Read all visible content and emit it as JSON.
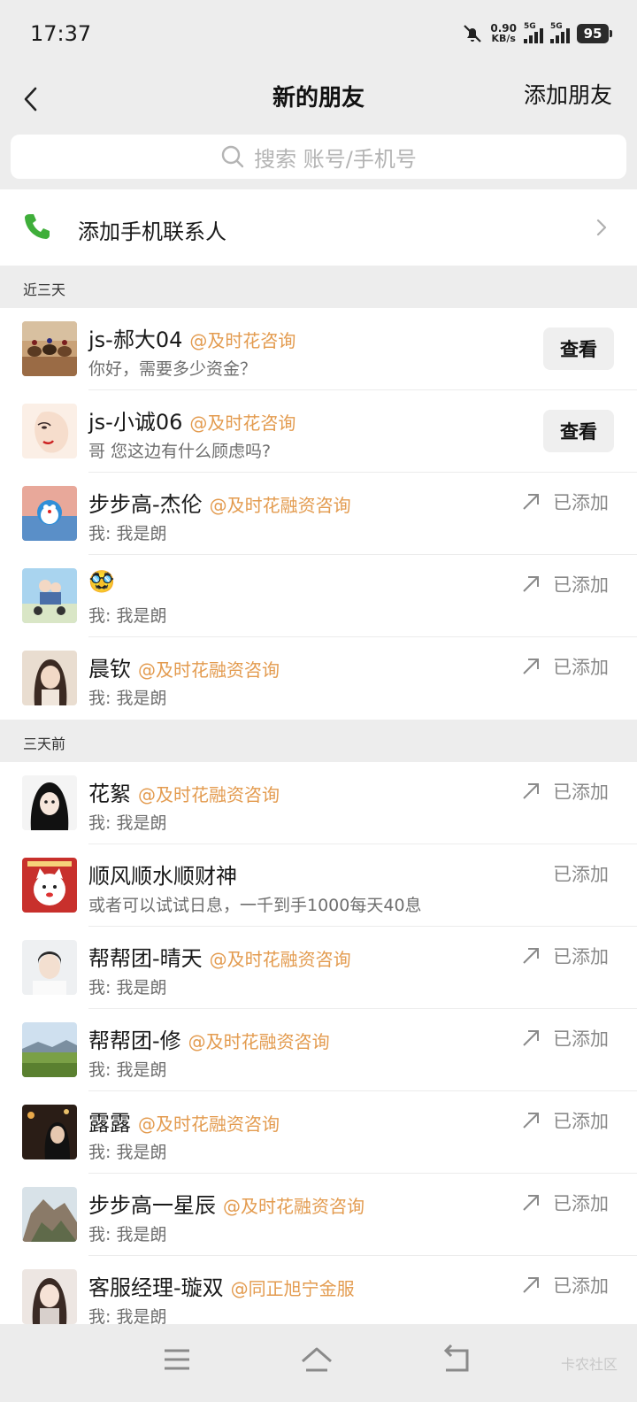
{
  "status": {
    "time": "17:37",
    "speed_value": "0.90",
    "speed_unit": "KB/s",
    "sig1": "5G",
    "sig2": "5G",
    "battery": "95"
  },
  "nav": {
    "title": "新的朋友",
    "action": "添加朋友"
  },
  "search": {
    "placeholder": "搜索 账号/手机号"
  },
  "phone_contacts": {
    "label": "添加手机联系人"
  },
  "sections": [
    {
      "title": "近三天",
      "items": [
        {
          "name": "js-郝大04",
          "org": "@及时花咨询",
          "message": "你好，需要多少资金？",
          "action": "查看",
          "avatar_icon": "horses-photo"
        },
        {
          "name": "js-小诚06",
          "org": "@及时花咨询",
          "message": "哥 您这边有什么顾虑吗?",
          "action": "查看",
          "avatar_icon": "face-illustration"
        },
        {
          "name": "步步高-杰伦",
          "org": "@及时花融资咨询",
          "message": "我: 我是朗",
          "action": "已添加",
          "avatar_icon": "doraemon-image"
        },
        {
          "name": "🥸",
          "org": "",
          "message": "我: 我是朗",
          "action": "已添加",
          "avatar_icon": "anime-scooter-image"
        },
        {
          "name": "晨钦",
          "org": "@及时花融资咨询",
          "message": "我: 我是朗",
          "action": "已添加",
          "avatar_icon": "woman-portrait"
        }
      ]
    },
    {
      "title": "三天前",
      "items": [
        {
          "name": "花絮",
          "org": "@及时花融资咨询",
          "message": "我: 我是朗",
          "action": "已添加",
          "avatar_icon": "anime-girl-portrait"
        },
        {
          "name": "顺风顺水顺财神",
          "org": "",
          "message": "或者可以试试日息，一千到手1000每天40息",
          "action": "已添加",
          "avatar_icon": "lucky-cat-image"
        },
        {
          "name": "帮帮团-晴天",
          "org": "@及时花融资咨询",
          "message": "我: 我是朗",
          "action": "已添加",
          "avatar_icon": "man-portrait"
        },
        {
          "name": "帮帮团-修",
          "org": "@及时花融资咨询",
          "message": "我: 我是朗",
          "action": "已添加",
          "avatar_icon": "landscape-photo"
        },
        {
          "name": "露露",
          "org": "@及时花融资咨询",
          "message": "我: 我是朗",
          "action": "已添加",
          "avatar_icon": "night-portrait"
        },
        {
          "name": "步步高一星辰",
          "org": "@及时花融资咨询",
          "message": "我: 我是朗",
          "action": "已添加",
          "avatar_icon": "mountain-photo"
        },
        {
          "name": "客服经理-璇双",
          "org": "@同正旭宁金服",
          "message": "我: 我是朗",
          "action": "已添加",
          "avatar_icon": "woman-selfie"
        }
      ]
    }
  ],
  "bottom_nav": {
    "watermark": "卡农社区"
  },
  "colors": {
    "org": "#e39b4f",
    "phone_green": "#3fae3a",
    "background": "#ededed"
  }
}
